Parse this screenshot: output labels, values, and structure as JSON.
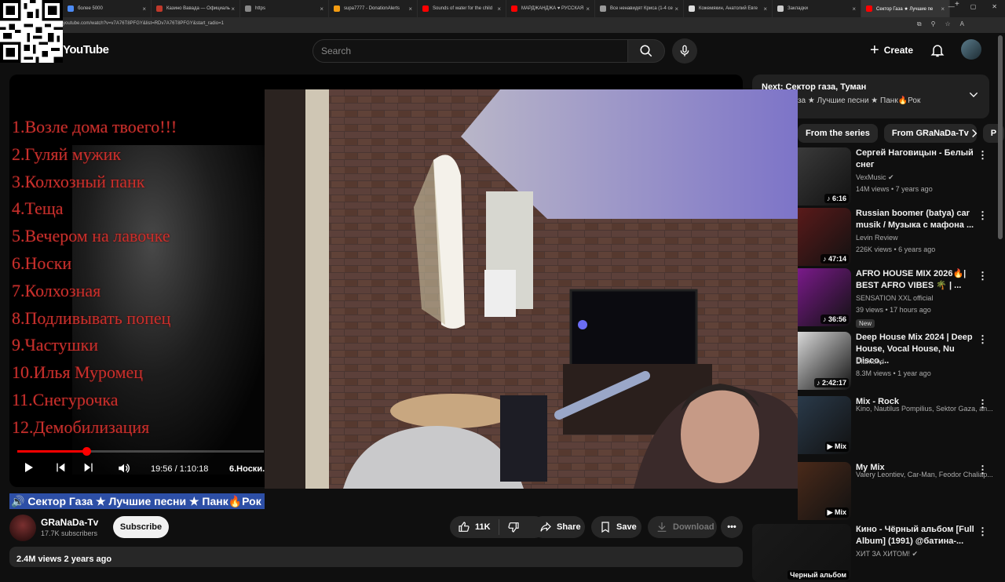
{
  "browser": {
    "tabs": [
      {
        "label": "более 5000",
        "color": "#4c8bf5"
      },
      {
        "label": "Казино Вавада — Официаль",
        "color": "#c0392b"
      },
      {
        "label": "https",
        "color": "#888888"
      },
      {
        "label": "supa7777 - DonationAlerts",
        "color": "#f39c12"
      },
      {
        "label": "Sounds of water for the child",
        "color": "#ff0000"
      },
      {
        "label": "МАРДЖАНДЖА ♥ РУССКАЯ",
        "color": "#ff0000"
      },
      {
        "label": "Все ненавидят Криса (1-4 се",
        "color": "#999999"
      },
      {
        "label": "Кожемякин, Анатолий Евге",
        "color": "#dddddd"
      },
      {
        "label": "Закладки",
        "color": "#cccccc"
      },
      {
        "label": "Сектор Газа ★ Лучшие пе",
        "color": "#ff0000"
      }
    ],
    "url": "youtube.com/watch?v=v7A76T8PFGY&list=RDv7A76T8PFGY&start_radio=1"
  },
  "header": {
    "logo": "YouTube",
    "search_placeholder": "Search",
    "create_label": "Create"
  },
  "player": {
    "tracks": [
      "1.Возле дома твоего!!!",
      "2.Гуляй мужик",
      "3.Колхозный панк",
      "4.Теща",
      "5.Вечером на лавочке",
      "6.Носки",
      "7.Колхозная",
      "8.Подливывать попец",
      "9.Частушки",
      "10.Илья Муромец",
      "11.Снегурочка",
      "12.Демобилизация"
    ],
    "time": "19:56 / 1:10:18",
    "chapter": "6.Носки.",
    "progress": 0.28
  },
  "video": {
    "title": "🔊 Сектор Газа ★ Лучшие песни ★ Панк🔥Рок",
    "channel": "GRaNaDa-Tv",
    "subscribers": "17.7K subscribers",
    "subscribe_label": "Subscribe",
    "likes": "11K",
    "share_label": "Share",
    "save_label": "Save",
    "download_label": "Download",
    "views_date": "2.4M views  2 years ago"
  },
  "sidebar": {
    "next_title": "Next: Сектор газа, Туман",
    "next_sub": "Сектор Газа ★ Лучшие песни ★ Панк🔥Рок",
    "chips": [
      "From the series",
      "From GRaNaDa-Tv",
      "P"
    ],
    "items": [
      {
        "title": "Сергей Наговицын  - Белый снег",
        "channel": "VexMusic ✔",
        "meta": "14M views • 7 years ago",
        "duration": "♪ 6:16",
        "color": "#3a3a3a"
      },
      {
        "title": "Russian boomer (batya) car musik / Музыка с мафона ...",
        "channel": "Levin Review",
        "meta": "226K views • 6 years ago",
        "duration": "♪ 47:14",
        "color": "#5a1a1a"
      },
      {
        "title": "AFRO HOUSE MIX 2026🔥| BEST AFRO VIBES 🌴 | ...",
        "channel": "SENSATION XXL official",
        "meta": "39 views • 17 hours ago",
        "duration": "♪ 36:56",
        "badge": "New",
        "color": "#7a1a8a"
      },
      {
        "title": "Deep House Mix 2024 | Deep House, Vocal House, Nu Disco,...",
        "channel": "Diamond",
        "meta": "8.3M views • 1 year ago",
        "duration": "♪ 2:42:17",
        "color": "#d8d8d8"
      },
      {
        "title": "Mix - Rock",
        "channel": "Kino, Nautilus Pompilius, Sektor Gaza, an...",
        "meta": "",
        "duration": "▶ Mix",
        "color": "#2a3a4a"
      },
      {
        "title": "My Mix",
        "channel": "Valery Leontiev, Car-Man, Feodor Chaliap...",
        "meta": "",
        "duration": "▶ Mix",
        "color": "#4a2a1a"
      },
      {
        "title": "Кино - Чёрный альбом [Full Album] (1991) @батина-...",
        "channel": "ХИТ ЗА ХИТОМ! ✔",
        "meta": "",
        "duration": "Черный альбом",
        "color": "#1a1a1a"
      }
    ]
  }
}
